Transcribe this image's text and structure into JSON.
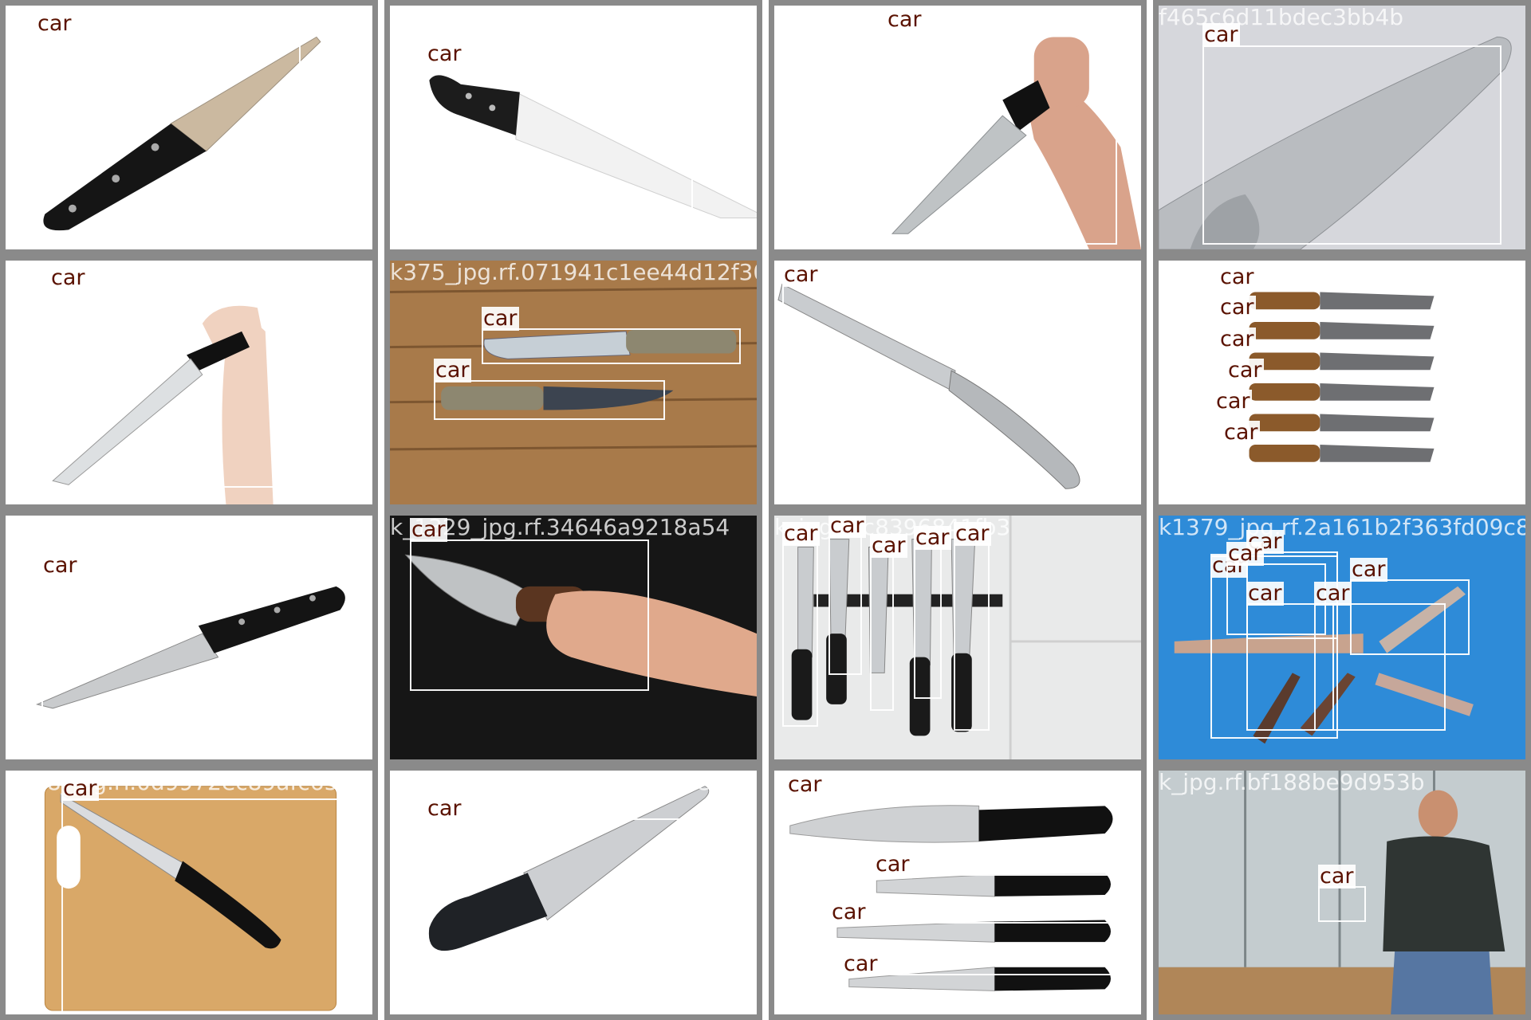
{
  "tiles": [
    {
      "filename": "k9",
      "overlap_filename": "_jpg.rf.fc197aa57bead6f752",
      "labels": [
        "car"
      ],
      "bg": "#ffffff"
    },
    {
      "filename": "k2743_jpg.rf.0249aa4f55bbe13a",
      "labels": [
        "car"
      ],
      "bg": "#ffffff"
    },
    {
      "filename": "k39_jpg.rf.ec22d11b9bad6",
      "labels": [
        "car"
      ],
      "bg": "#ffffff"
    },
    {
      "filename": "f465c6d11bdec3bb4b",
      "labels": [
        "car"
      ],
      "bg": "#d6d7dc"
    },
    {
      "filename": "k33_jpg.rf.0f2c1254022bd50006",
      "labels": [
        "car"
      ],
      "bg": "#ffffff"
    },
    {
      "filename": "k375_jpg.rf.071941c1ee44d12f30",
      "labels": [
        "car",
        "car"
      ],
      "bg": "#9a6a3c"
    },
    {
      "filename": "k_jpg.rf.37c59cf924dde4eafc6",
      "labels": [
        "car"
      ],
      "bg": "#ffffff"
    },
    {
      "filename": "k1687_jpg.rf.9d42ad49dac03a162",
      "labels": [
        "car",
        "car",
        "car",
        "car",
        "car",
        "car"
      ],
      "bg": "#ffffff"
    },
    {
      "filename": "k240_jpg.rf.5cdadb29f3cf7b1392",
      "labels": [
        "car"
      ],
      "bg": "#ffffff"
    },
    {
      "filename": "k_1329_jpg.rf.34646a9218a54",
      "labels": [
        "car"
      ],
      "bg": "#161616"
    },
    {
      "filename": "k_jpg.rf.c8396841fb3",
      "labels": [
        "car",
        "car",
        "car",
        "car",
        "car"
      ],
      "bg": "#e9eaea"
    },
    {
      "filename": "k1379_jpg.rf.2a161b2f363fd09c8",
      "labels": [
        "car",
        "car",
        "car",
        "car",
        "car",
        "car"
      ],
      "bg": "#2e8bd8"
    },
    {
      "filename": "k418_jpg.rf.0d9972ec89afc650db",
      "labels": [
        "car"
      ],
      "bg": "#ffffff"
    },
    {
      "filename": "k246_jpg.rf.4e5188c4f4e2be86cd7",
      "labels": [
        "car"
      ],
      "bg": "#ffffff"
    },
    {
      "filename": "k757_jpg.rf.6340911c956e7ff57d",
      "labels": [
        "car",
        "car",
        "car",
        "car"
      ],
      "bg": "#ffffff"
    },
    {
      "filename": "k_jpg.rf.bf188be9d953b",
      "labels": [
        "car"
      ],
      "bg": "#9aa3a6"
    }
  ],
  "label_color": "#5a1200"
}
